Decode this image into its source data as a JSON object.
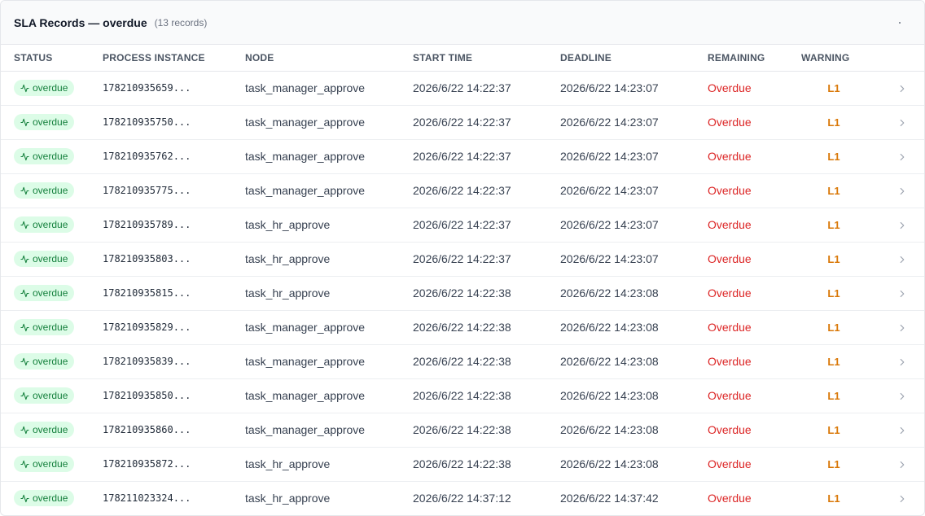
{
  "header": {
    "title": "SLA Records — overdue",
    "count": "(13 records)"
  },
  "columns": {
    "status": "STATUS",
    "process_instance": "PROCESS INSTANCE",
    "node": "NODE",
    "start_time": "START TIME",
    "deadline": "DEADLINE",
    "remaining": "REMAINING",
    "warning": "WARNING"
  },
  "colors": {
    "badge_bg": "#dcfce7",
    "badge_text": "#15803d",
    "overdue": "#dc2626",
    "warning": "#d97706"
  },
  "icons": {
    "status": "activity-icon",
    "row_action": "chevron-right-icon"
  },
  "rows": [
    {
      "status": "overdue",
      "process_instance": "178210935659...",
      "node": "task_manager_approve",
      "start_time": "2026/6/22 14:22:37",
      "deadline": "2026/6/22 14:23:07",
      "remaining": "Overdue",
      "warning": "L1"
    },
    {
      "status": "overdue",
      "process_instance": "178210935750...",
      "node": "task_manager_approve",
      "start_time": "2026/6/22 14:22:37",
      "deadline": "2026/6/22 14:23:07",
      "remaining": "Overdue",
      "warning": "L1"
    },
    {
      "status": "overdue",
      "process_instance": "178210935762...",
      "node": "task_manager_approve",
      "start_time": "2026/6/22 14:22:37",
      "deadline": "2026/6/22 14:23:07",
      "remaining": "Overdue",
      "warning": "L1"
    },
    {
      "status": "overdue",
      "process_instance": "178210935775...",
      "node": "task_manager_approve",
      "start_time": "2026/6/22 14:22:37",
      "deadline": "2026/6/22 14:23:07",
      "remaining": "Overdue",
      "warning": "L1"
    },
    {
      "status": "overdue",
      "process_instance": "178210935789...",
      "node": "task_hr_approve",
      "start_time": "2026/6/22 14:22:37",
      "deadline": "2026/6/22 14:23:07",
      "remaining": "Overdue",
      "warning": "L1"
    },
    {
      "status": "overdue",
      "process_instance": "178210935803...",
      "node": "task_hr_approve",
      "start_time": "2026/6/22 14:22:37",
      "deadline": "2026/6/22 14:23:07",
      "remaining": "Overdue",
      "warning": "L1"
    },
    {
      "status": "overdue",
      "process_instance": "178210935815...",
      "node": "task_hr_approve",
      "start_time": "2026/6/22 14:22:38",
      "deadline": "2026/6/22 14:23:08",
      "remaining": "Overdue",
      "warning": "L1"
    },
    {
      "status": "overdue",
      "process_instance": "178210935829...",
      "node": "task_manager_approve",
      "start_time": "2026/6/22 14:22:38",
      "deadline": "2026/6/22 14:23:08",
      "remaining": "Overdue",
      "warning": "L1"
    },
    {
      "status": "overdue",
      "process_instance": "178210935839...",
      "node": "task_manager_approve",
      "start_time": "2026/6/22 14:22:38",
      "deadline": "2026/6/22 14:23:08",
      "remaining": "Overdue",
      "warning": "L1"
    },
    {
      "status": "overdue",
      "process_instance": "178210935850...",
      "node": "task_manager_approve",
      "start_time": "2026/6/22 14:22:38",
      "deadline": "2026/6/22 14:23:08",
      "remaining": "Overdue",
      "warning": "L1"
    },
    {
      "status": "overdue",
      "process_instance": "178210935860...",
      "node": "task_manager_approve",
      "start_time": "2026/6/22 14:22:38",
      "deadline": "2026/6/22 14:23:08",
      "remaining": "Overdue",
      "warning": "L1"
    },
    {
      "status": "overdue",
      "process_instance": "178210935872...",
      "node": "task_hr_approve",
      "start_time": "2026/6/22 14:22:38",
      "deadline": "2026/6/22 14:23:08",
      "remaining": "Overdue",
      "warning": "L1"
    },
    {
      "status": "overdue",
      "process_instance": "178211023324...",
      "node": "task_hr_approve",
      "start_time": "2026/6/22 14:37:12",
      "deadline": "2026/6/22 14:37:42",
      "remaining": "Overdue",
      "warning": "L1"
    }
  ]
}
